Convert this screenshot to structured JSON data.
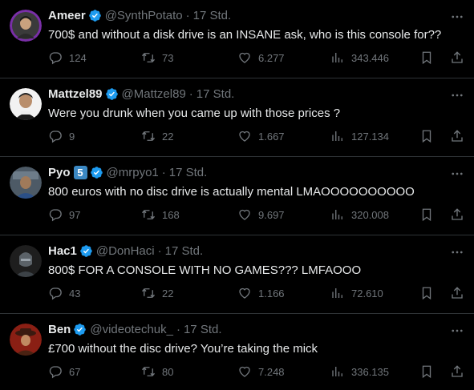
{
  "colors": {
    "background": "#000000",
    "text": "#e7e9ea",
    "muted": "#71767b",
    "verified": "#1d9bf0",
    "divider": "#2f3336"
  },
  "tweets": [
    {
      "name": "Ameer",
      "handle": "@SynthPotato",
      "time": "17 Std.",
      "text": "700$ and without a disk drive is an INSANE ask, who is this console for??",
      "replies": "124",
      "retweets": "73",
      "likes": "6.277",
      "views": "343.446"
    },
    {
      "name": "Mattzel89",
      "handle": "@Mattzel89",
      "time": "17 Std.",
      "text": "Were you drunk when you came up with those prices ?",
      "replies": "9",
      "retweets": "22",
      "likes": "1.667",
      "views": "127.134"
    },
    {
      "name": "Pyo",
      "badge": "5",
      "handle": "@mrpyo1",
      "time": "17 Std.",
      "text": "800 euros with no disc drive is actually mental LMAOOOOOOOOOO",
      "replies": "97",
      "retweets": "168",
      "likes": "9.697",
      "views": "320.008"
    },
    {
      "name": "Hac1",
      "handle": "@DonHaci",
      "time": "17 Std.",
      "text": "800$ FOR A CONSOLE WITH NO GAMES??? LMFAOOO",
      "replies": "43",
      "retweets": "22",
      "likes": "1.166",
      "views": "72.610"
    },
    {
      "name": "Ben",
      "handle": "@videotechuk_",
      "time": "17 Std.",
      "text": "£700 without the disc drive? You’re taking the mick",
      "replies": "67",
      "retweets": "80",
      "likes": "7.248",
      "views": "336.135"
    }
  ],
  "separator": "·",
  "icons": [
    "verified-badge-icon",
    "more-icon",
    "reply-icon",
    "retweet-icon",
    "like-icon",
    "views-icon",
    "bookmark-icon",
    "share-icon"
  ]
}
